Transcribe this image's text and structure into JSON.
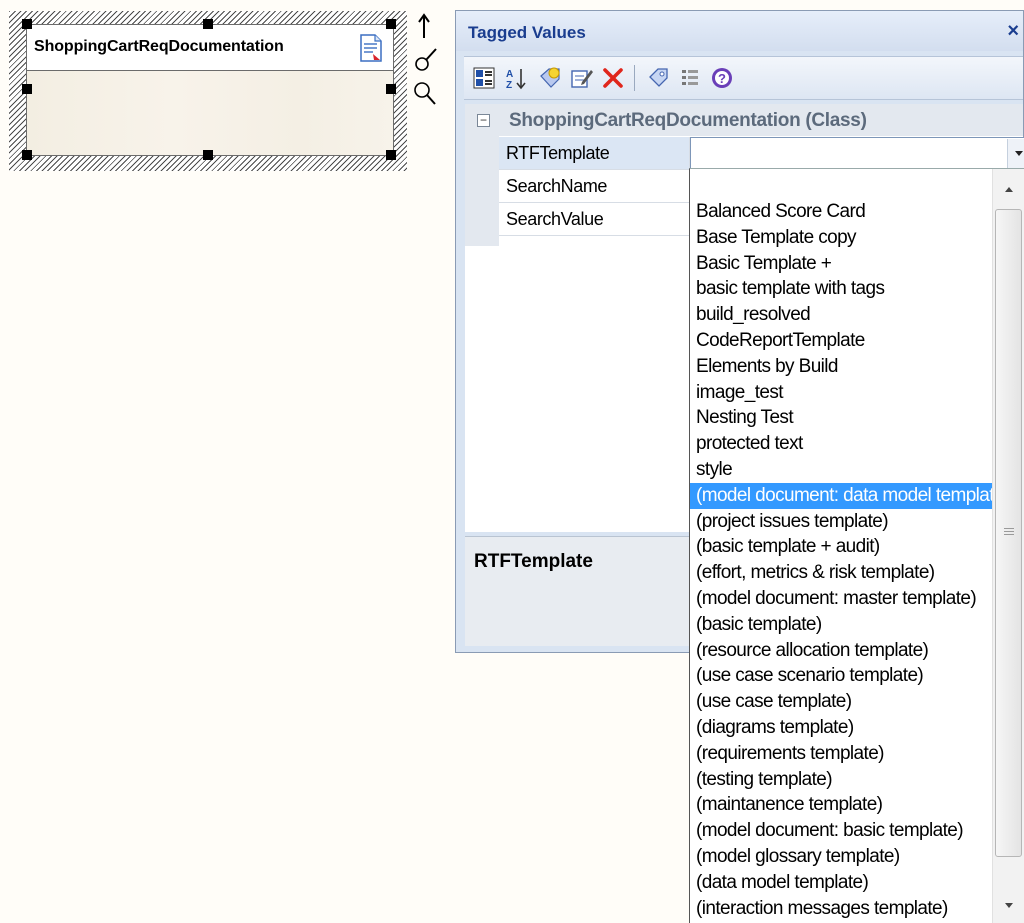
{
  "diagram": {
    "class_name": "ShoppingCartReqDocumentation"
  },
  "tagged_values": {
    "title": "Tagged Values",
    "close": "×",
    "toolbar": {
      "icons": [
        "categorized-view-icon",
        "sort-alpha-icon",
        "new-tag-icon",
        "edit-notes-icon",
        "delete-icon",
        "tag-icon",
        "filter-icon",
        "help-icon"
      ]
    },
    "group": {
      "toggle": "−",
      "label": "ShoppingCartReqDocumentation (Class)"
    },
    "properties": [
      {
        "name": "RTFTemplate",
        "value": ""
      },
      {
        "name": "SearchName",
        "value": ""
      },
      {
        "name": "SearchValue",
        "value": ""
      }
    ],
    "description_title": "RTFTemplate"
  },
  "dropdown": {
    "selected_index": 11,
    "items": [
      "Balanced Score Card",
      "Base Template copy",
      "Basic Template +",
      "basic template with tags",
      "build_resolved",
      "CodeReportTemplate",
      "Elements by Build",
      "image_test",
      "Nesting Test",
      "protected text",
      "style",
      "(model document: data model template)",
      "(project issues template)",
      "(basic template + audit)",
      "(effort, metrics & risk template)",
      "(model document: master template)",
      "(basic template)",
      "(resource allocation template)",
      "(use case scenario template)",
      "(use case template)",
      "(diagrams template)",
      "(requirements template)",
      "(testing template)",
      "(maintanence template)",
      "(model document: basic template)",
      "(model glossary template)",
      "(data model template)",
      "(interaction messages template)"
    ]
  },
  "colors": {
    "highlight": "#3399ff",
    "title": "#1a3d8f"
  }
}
